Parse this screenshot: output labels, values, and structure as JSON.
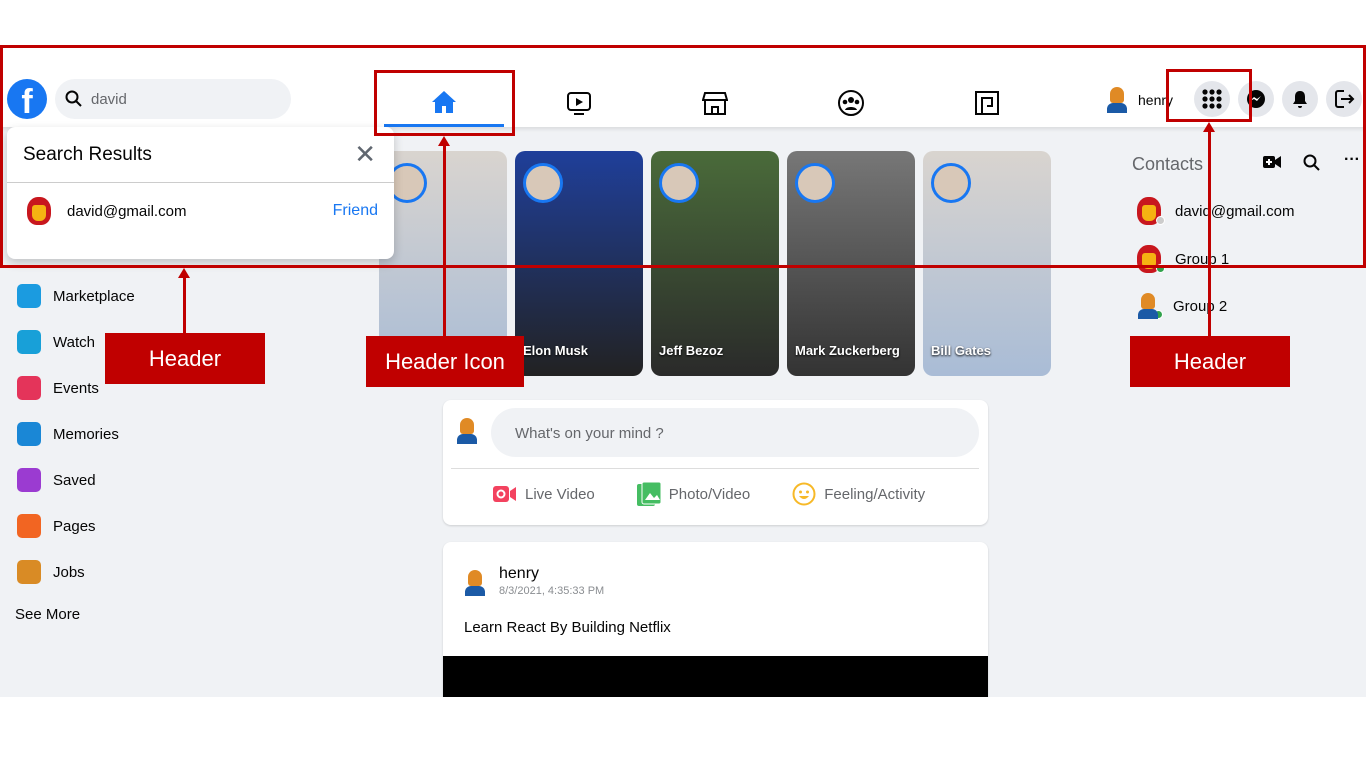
{
  "header": {
    "logo": "f",
    "search_value": "david",
    "user_name": "henry",
    "nav_icons": [
      "home-icon",
      "watch-icon",
      "marketplace-icon",
      "groups-icon",
      "gaming-icon"
    ],
    "right_icons": [
      "menu-grid-icon",
      "messenger-icon",
      "bell-icon",
      "logout-icon"
    ],
    "accent": "#1877f2"
  },
  "search_results": {
    "title": "Search Results",
    "items": [
      {
        "email": "david@gmail.com",
        "action": "Friend"
      }
    ]
  },
  "sidebar": {
    "items": [
      {
        "label": "Marketplace",
        "color": "#1b9be0"
      },
      {
        "label": "Watch",
        "color": "#18a0d8"
      },
      {
        "label": "Events",
        "color": "#e4345a"
      },
      {
        "label": "Memories",
        "color": "#1a87d6"
      },
      {
        "label": "Saved",
        "color": "#9b3bd1"
      },
      {
        "label": "Pages",
        "color": "#f26522"
      },
      {
        "label": "Jobs",
        "color": "#d98b25"
      }
    ],
    "see_more": "See More"
  },
  "stories": [
    {
      "name": ""
    },
    {
      "name": "Elon Musk"
    },
    {
      "name": "Jeff Bezoz"
    },
    {
      "name": "Mark Zuckerberg"
    },
    {
      "name": "Bill Gates"
    }
  ],
  "composer": {
    "placeholder": "What's on your mind ?",
    "actions": [
      {
        "label": "Live Video",
        "color": "#f3425f"
      },
      {
        "label": "Photo/Video",
        "color": "#45bd62"
      },
      {
        "label": "Feeling/Activity",
        "color": "#f7b928"
      }
    ]
  },
  "post": {
    "author": "henry",
    "timestamp": "8/3/2021, 4:35:33 PM",
    "text": "Learn React By Building Netflix"
  },
  "contacts": {
    "title": "Contacts",
    "items": [
      {
        "name": "david@gmail.com",
        "status": "offline"
      },
      {
        "name": "Group 1",
        "status": "online"
      },
      {
        "name": "Group 2",
        "status": "online"
      }
    ]
  },
  "annotations": {
    "left": "Header",
    "center": "Header Icon",
    "right": "Header",
    "color": "#c00000"
  }
}
